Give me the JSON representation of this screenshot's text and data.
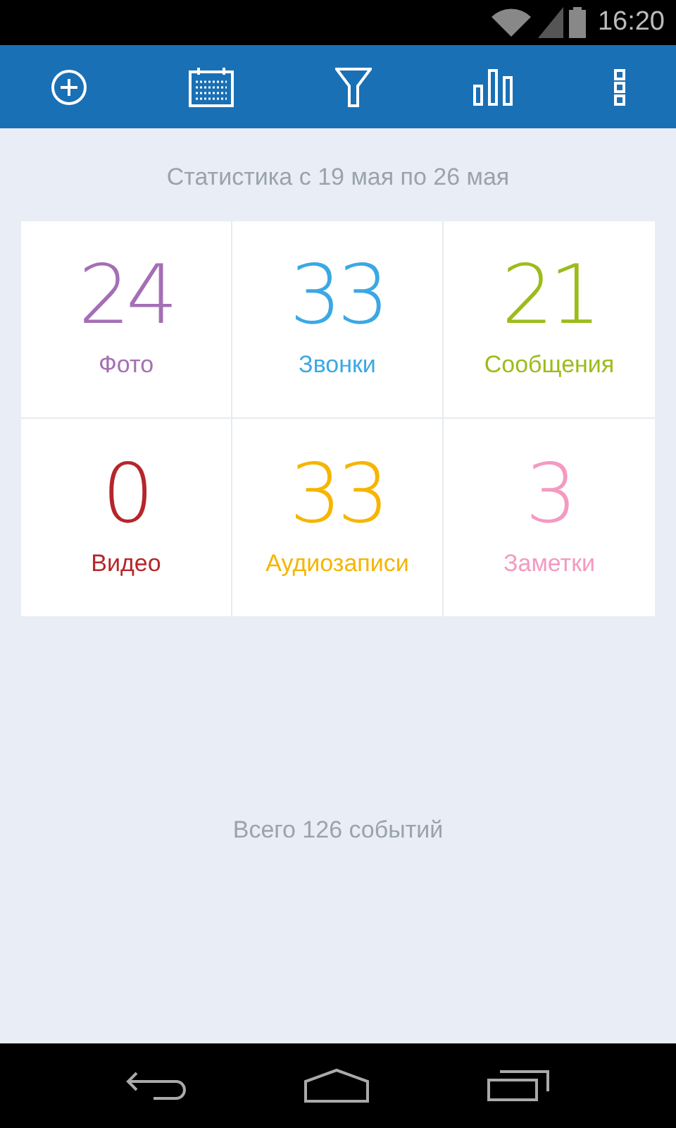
{
  "status_bar": {
    "time": "16:20"
  },
  "toolbar": {
    "actions": [
      {
        "kind": "add"
      },
      {
        "kind": "calendar"
      },
      {
        "kind": "filter"
      },
      {
        "kind": "chart"
      },
      {
        "kind": "more"
      }
    ]
  },
  "period": "Статистика с 19 мая по 26 мая",
  "stats": [
    {
      "value": "24",
      "label": "Фото",
      "color": "#a46fb5"
    },
    {
      "value": "33",
      "label": "Звонки",
      "color": "#3ba8e4"
    },
    {
      "value": "21",
      "label": "Сообщения",
      "color": "#9cbc1b"
    },
    {
      "value": "0",
      "label": "Видео",
      "color": "#b5262a"
    },
    {
      "value": "33",
      "label": "Аудиозаписи",
      "color": "#f5b500"
    },
    {
      "value": "3",
      "label": "Заметки",
      "color": "#f49ac1"
    }
  ],
  "total": "Всего 126 событий"
}
